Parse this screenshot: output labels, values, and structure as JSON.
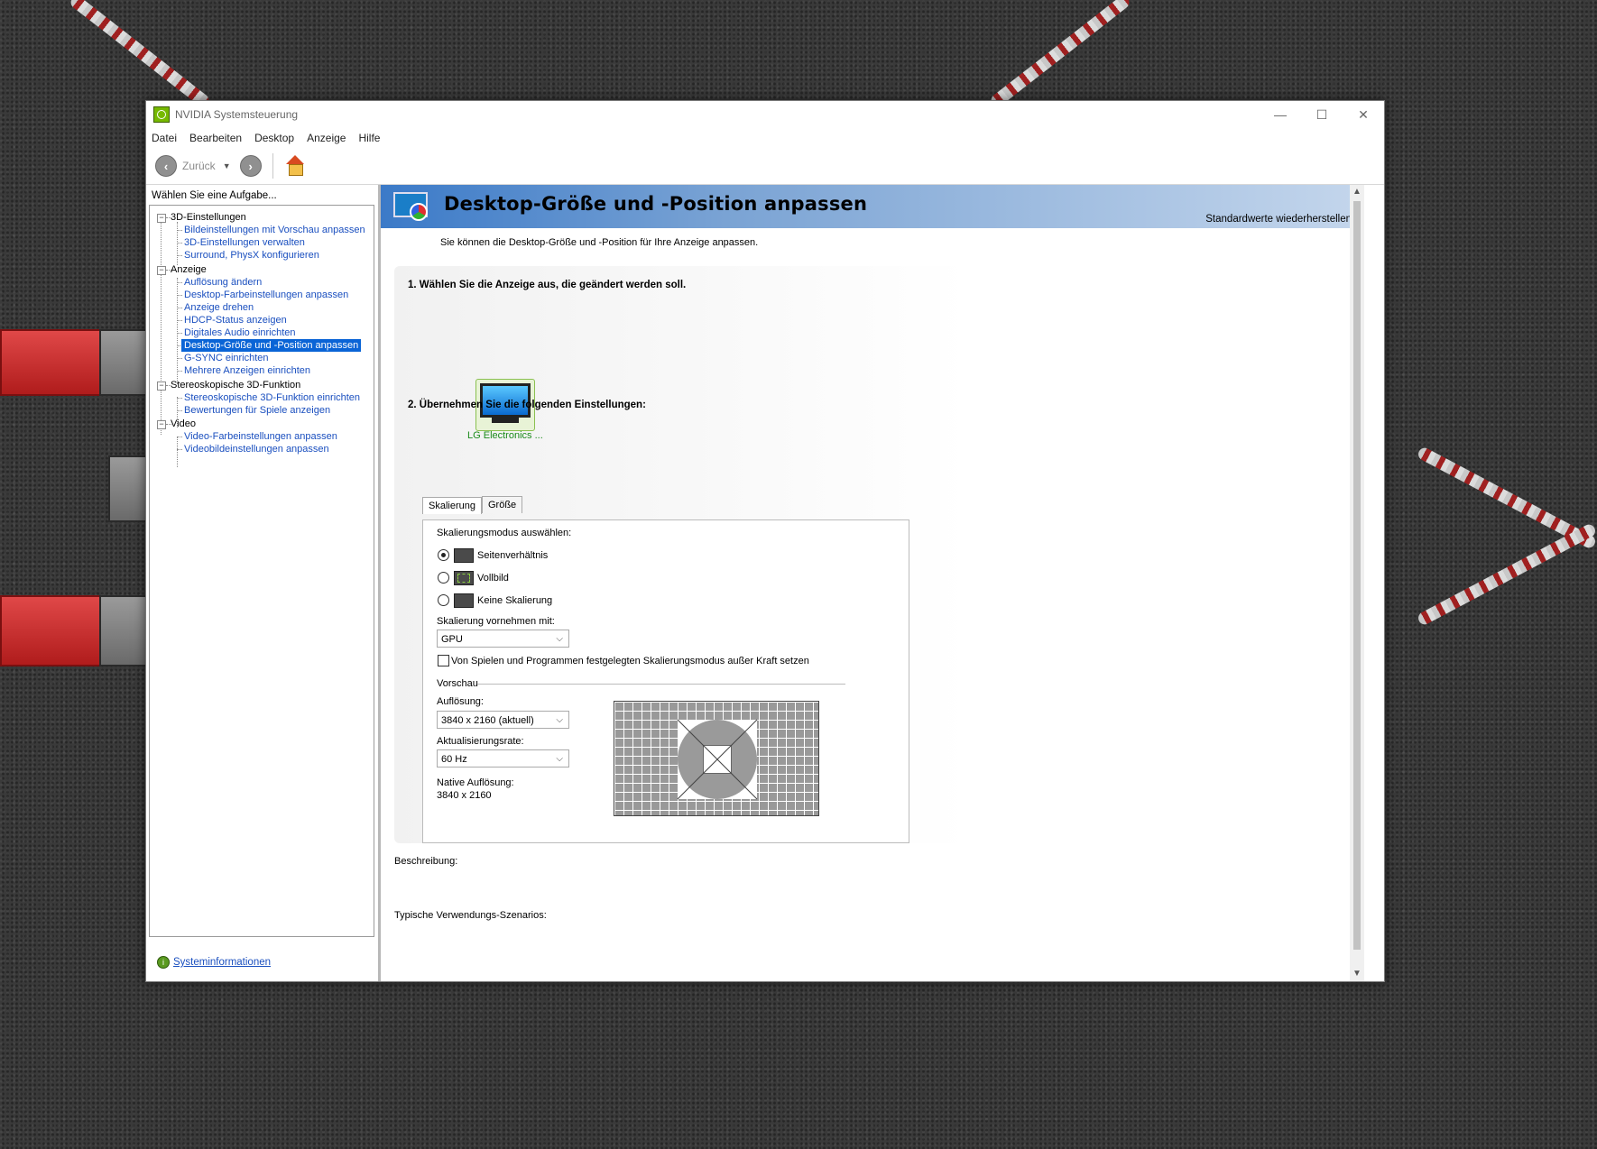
{
  "window": {
    "title": "NVIDIA Systemsteuerung",
    "minimize_glyph": "—",
    "maximize_glyph": "☐",
    "close_glyph": "✕"
  },
  "menu": [
    "Datei",
    "Bearbeiten",
    "Desktop",
    "Anzeige",
    "Hilfe"
  ],
  "toolbar": {
    "back_label": "Zurück",
    "back_icon": "arrow-left-circle-icon",
    "forward_icon": "arrow-right-circle-icon",
    "home_icon": "home-icon"
  },
  "sidebar": {
    "header": "Wählen Sie eine Aufgabe...",
    "categories": [
      {
        "label": "3D-Einstellungen",
        "items": [
          "Bildeinstellungen mit Vorschau anpassen",
          "3D-Einstellungen verwalten",
          "Surround, PhysX konfigurieren"
        ]
      },
      {
        "label": "Anzeige",
        "items": [
          "Auflösung ändern",
          "Desktop-Farbeinstellungen anpassen",
          "Anzeige drehen",
          "HDCP-Status anzeigen",
          "Digitales Audio einrichten",
          "Desktop-Größe und -Position anpassen",
          "G-SYNC einrichten",
          "Mehrere Anzeigen einrichten"
        ]
      },
      {
        "label": "Stereoskopische 3D-Funktion",
        "items": [
          "Stereoskopische 3D-Funktion einrichten",
          "Bewertungen für Spiele anzeigen"
        ]
      },
      {
        "label": "Video",
        "items": [
          "Video-Farbeinstellungen anpassen",
          "Videobildeinstellungen anpassen"
        ]
      }
    ],
    "selected_item": "Desktop-Größe und -Position anpassen",
    "system_info": "Systeminformationen"
  },
  "page": {
    "title": "Desktop-Größe und -Position anpassen",
    "restore_defaults": "Standardwerte wiederherstellen",
    "intro": "Sie können die Desktop-Größe und -Position für Ihre Anzeige anpassen.",
    "step1": "1. Wählen Sie die Anzeige aus, die geändert werden soll.",
    "display_name": "LG Electronics ...",
    "step2": "2. Übernehmen Sie die folgenden Einstellungen:",
    "tabs": [
      "Skalierung",
      "Größe"
    ],
    "scaling_mode_label": "Skalierungsmodus auswählen:",
    "scaling_modes": [
      "Seitenverhältnis",
      "Vollbild",
      "Keine Skalierung"
    ],
    "scaling_selected": "Seitenverhältnis",
    "perform_scaling_label": "Skalierung vornehmen mit:",
    "perform_scaling_value": "GPU",
    "override_checkbox": "Von Spielen und Programmen festgelegten Skalierungsmodus außer Kraft setzen",
    "override_checked": false,
    "preview_label": "Vorschau",
    "resolution_label": "Auflösung:",
    "resolution_value": "3840 x 2160 (aktuell)",
    "refresh_label": "Aktualisierungsrate:",
    "refresh_value": "60 Hz",
    "native_label": "Native Auflösung:",
    "native_value": "3840 x 2160",
    "description_label": "Beschreibung:",
    "scenarios_label": "Typische Verwendungs-Szenarios:"
  },
  "colors": {
    "accent": "#0a64d6",
    "link": "#1a4fbf",
    "nvidia_green": "#76b900",
    "banner_start": "#3b7ac8"
  }
}
